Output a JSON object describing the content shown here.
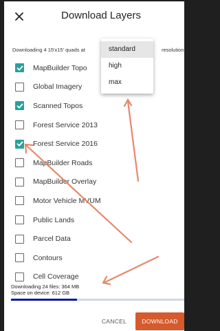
{
  "header": {
    "title": "Download Layers",
    "close_icon": "close-icon"
  },
  "info": {
    "text": "Downloading 4 15'x15' quads at",
    "tail": "resolution"
  },
  "dropdown": {
    "options": [
      "standard",
      "high",
      "max"
    ],
    "selected": "standard"
  },
  "layers": [
    {
      "label": "MapBuilder Topo",
      "checked": true
    },
    {
      "label": "Global Imagery",
      "checked": false
    },
    {
      "label": "Scanned Topos",
      "checked": true
    },
    {
      "label": "Forest Service 2013",
      "checked": false
    },
    {
      "label": "Forest Service 2016",
      "checked": true
    },
    {
      "label": "MapBuilder Roads",
      "checked": false
    },
    {
      "label": "MapBuilder Overlay",
      "checked": false
    },
    {
      "label": "Motor Vehicle MVUM",
      "checked": false
    },
    {
      "label": "Public Lands",
      "checked": false
    },
    {
      "label": "Parcel Data",
      "checked": false
    },
    {
      "label": "Contours",
      "checked": false
    },
    {
      "label": "Cell Coverage",
      "checked": false
    }
  ],
  "status": {
    "files": "Downloading 24 files: 364 MB",
    "space": "Space on device: 612 GB",
    "progress_fraction": 0.38
  },
  "footer": {
    "cancel_label": "CANCEL",
    "download_label": "DOWNLOAD"
  },
  "colors": {
    "checkbox_checked": "#2aa198",
    "download_button": "#d65a2c",
    "progress_fill": "#0a1a9c",
    "annotation_arrow": "#e8866a"
  }
}
